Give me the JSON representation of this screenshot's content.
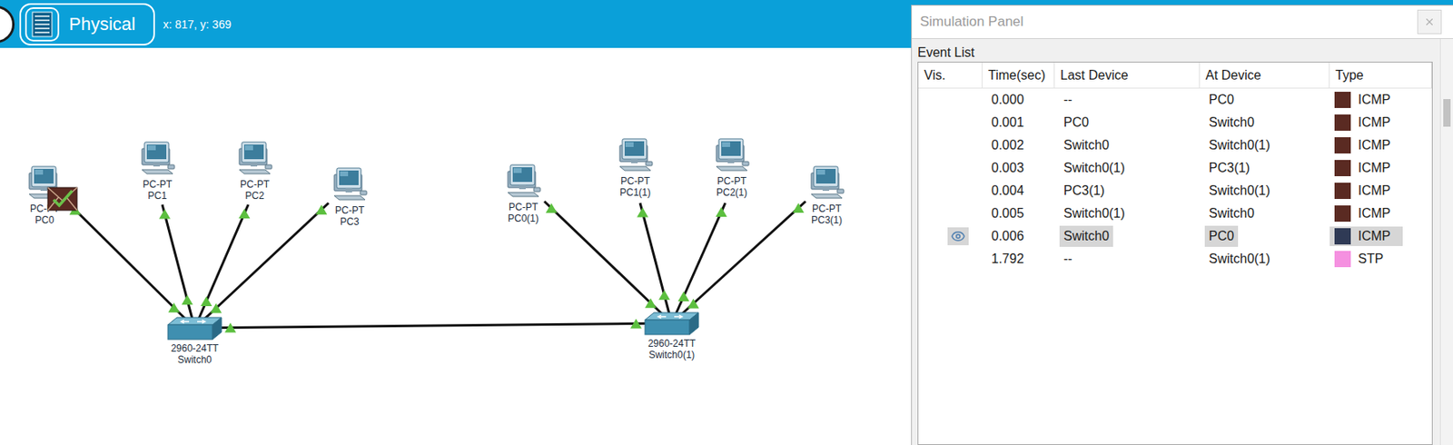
{
  "toolbar": {
    "mode": "Physical",
    "cursor": "x: 817, y: 369"
  },
  "devices": [
    {
      "name": "PC0",
      "model": "PC-PT",
      "kind": "pc"
    },
    {
      "name": "PC1",
      "model": "PC-PT",
      "kind": "pc"
    },
    {
      "name": "PC2",
      "model": "PC-PT",
      "kind": "pc"
    },
    {
      "name": "PC3",
      "model": "PC-PT",
      "kind": "pc"
    },
    {
      "name": "Switch0",
      "model": "2960-24TT",
      "kind": "switch"
    },
    {
      "name": "PC0(1)",
      "model": "PC-PT",
      "kind": "pc"
    },
    {
      "name": "PC1(1)",
      "model": "PC-PT",
      "kind": "pc"
    },
    {
      "name": "PC2(1)",
      "model": "PC-PT",
      "kind": "pc"
    },
    {
      "name": "PC3(1)",
      "model": "PC-PT",
      "kind": "pc"
    },
    {
      "name": "Switch0(1)",
      "model": "2960-24TT",
      "kind": "switch"
    }
  ],
  "links": [
    {
      "from": "PC0",
      "to": "Switch0",
      "up": true
    },
    {
      "from": "PC1",
      "to": "Switch0",
      "up": true
    },
    {
      "from": "PC2",
      "to": "Switch0",
      "up": true
    },
    {
      "from": "PC3",
      "to": "Switch0",
      "up": true
    },
    {
      "from": "Switch0",
      "to": "Switch0(1)",
      "up": true
    },
    {
      "from": "PC0(1)",
      "to": "Switch0(1)",
      "up": true
    },
    {
      "from": "PC1(1)",
      "to": "Switch0(1)",
      "up": true
    },
    {
      "from": "PC2(1)",
      "to": "Switch0(1)",
      "up": true
    },
    {
      "from": "PC3(1)",
      "to": "Switch0(1)",
      "up": true
    }
  ],
  "pdu": {
    "at": "PC0",
    "delivered": true
  },
  "simulation_panel": {
    "title": "Simulation Panel",
    "event_list": {
      "label": "Event List",
      "columns": [
        "Vis.",
        "Time(sec)",
        "Last Device",
        "At Device",
        "Type"
      ],
      "rows": [
        {
          "visible": false,
          "time": "0.000",
          "last": "--",
          "at": "PC0",
          "type": "ICMP",
          "color": "#5a2a22",
          "selected": false
        },
        {
          "visible": false,
          "time": "0.001",
          "last": "PC0",
          "at": "Switch0",
          "type": "ICMP",
          "color": "#5a2a22",
          "selected": false
        },
        {
          "visible": false,
          "time": "0.002",
          "last": "Switch0",
          "at": "Switch0(1)",
          "type": "ICMP",
          "color": "#5a2a22",
          "selected": false
        },
        {
          "visible": false,
          "time": "0.003",
          "last": "Switch0(1)",
          "at": "PC3(1)",
          "type": "ICMP",
          "color": "#5a2a22",
          "selected": false
        },
        {
          "visible": false,
          "time": "0.004",
          "last": "PC3(1)",
          "at": "Switch0(1)",
          "type": "ICMP",
          "color": "#5a2a22",
          "selected": false
        },
        {
          "visible": false,
          "time": "0.005",
          "last": "Switch0(1)",
          "at": "Switch0",
          "type": "ICMP",
          "color": "#5a2a22",
          "selected": false
        },
        {
          "visible": true,
          "time": "0.006",
          "last": "Switch0",
          "at": "PC0",
          "type": "ICMP",
          "color": "#2f3a55",
          "selected": true
        },
        {
          "visible": false,
          "time": "1.792",
          "last": "--",
          "at": "Switch0(1)",
          "type": "STP",
          "color": "#f590e0",
          "selected": false
        }
      ]
    }
  }
}
